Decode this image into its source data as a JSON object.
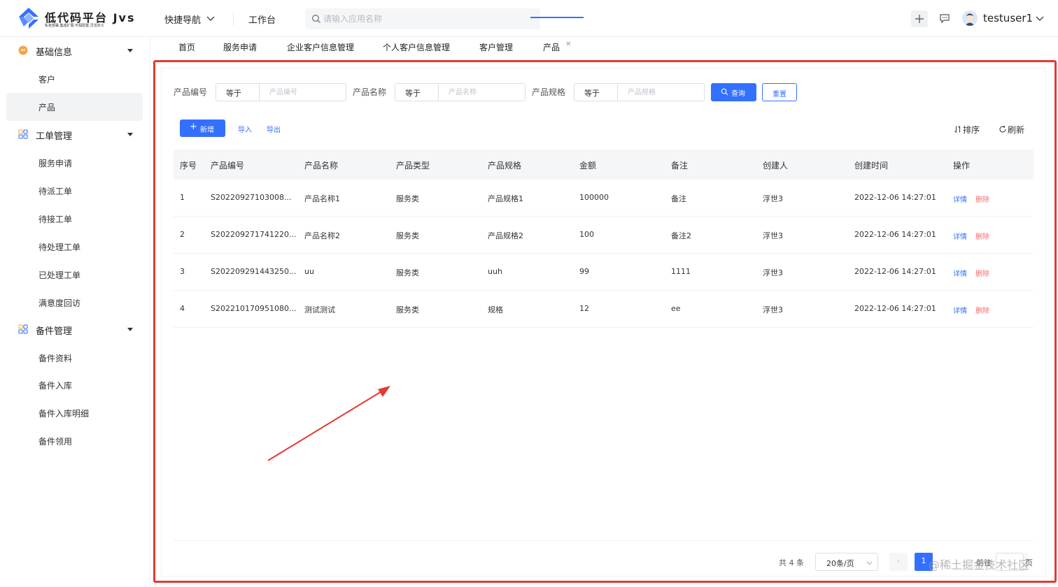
{
  "brand": {
    "title": "低代码平台 Jvs",
    "subtitle": "私有部署.集成扩展.可视配置.灵活定义"
  },
  "topbar": {
    "quick_nav": "快捷导航",
    "workbench": "工作台",
    "search_placeholder": "请输入应用名称",
    "username": "testuser1"
  },
  "sidebar": {
    "groups": [
      {
        "label": "基础信息",
        "icon": "basic-info-icon",
        "items": [
          "客户",
          "产品"
        ]
      },
      {
        "label": "工单管理",
        "icon": "grid-icon",
        "items": [
          "服务申请",
          "待派工单",
          "待接工单",
          "待处理工单",
          "已处理工单",
          "满意度回访"
        ]
      },
      {
        "label": "备件管理",
        "icon": "grid-icon",
        "items": [
          "备件资料",
          "备件入库",
          "备件入库明细",
          "备件领用"
        ]
      }
    ],
    "active_item": "产品"
  },
  "tabs": [
    "首页",
    "服务申请",
    "企业客户信息管理",
    "个人客户信息管理",
    "客户管理",
    "产品"
  ],
  "active_tab": "产品",
  "filters": [
    {
      "label": "产品编号",
      "operator": "等于",
      "placeholder": "产品编号"
    },
    {
      "label": "产品名称",
      "operator": "等于",
      "placeholder": "产品名称"
    },
    {
      "label": "产品规格",
      "operator": "等于",
      "placeholder": "产品规格"
    }
  ],
  "buttons": {
    "query": "查询",
    "reset": "重置",
    "add": "新增",
    "import": "导入",
    "export": "导出",
    "sort": "排序",
    "refresh": "刷新"
  },
  "table": {
    "columns": [
      "序号",
      "产品编号",
      "产品名称",
      "产品类型",
      "产品规格",
      "金额",
      "备注",
      "创建人",
      "创建时间",
      "操作"
    ],
    "rows": [
      {
        "index": "1",
        "code": "S20220927103008...",
        "name": "产品名称1",
        "type": "服务类",
        "spec": "产品规格1",
        "amount": "100000",
        "remark": "备注",
        "creator": "浮世3",
        "created": "2022-12-06 14:27:01"
      },
      {
        "index": "2",
        "code": "S202209271741220...",
        "name": "产品名称2",
        "type": "服务类",
        "spec": "产品规格2",
        "amount": "100",
        "remark": "备注2",
        "creator": "浮世3",
        "created": "2022-12-06 14:27:01"
      },
      {
        "index": "3",
        "code": "S202209291443250...",
        "name": "uu",
        "type": "服务类",
        "spec": "uuh",
        "amount": "99",
        "remark": "1111",
        "creator": "浮世3",
        "created": "2022-12-06 14:27:01"
      },
      {
        "index": "4",
        "code": "S202210170951080...",
        "name": "测试测试",
        "type": "服务类",
        "spec": "规格",
        "amount": "12",
        "remark": "ee",
        "creator": "浮世3",
        "created": "2022-12-06 14:27:01"
      }
    ],
    "action_detail": "详情",
    "action_delete": "删除"
  },
  "pagination": {
    "total": "共 4 条",
    "page_size": "20条/页",
    "current": "1",
    "goto": "前往",
    "goto_end": "页"
  },
  "watermark": "@稀土掘金技术社区",
  "colors": {
    "accent": "#3370ff",
    "danger": "#f56c6c",
    "annotation": "#e43a33"
  }
}
